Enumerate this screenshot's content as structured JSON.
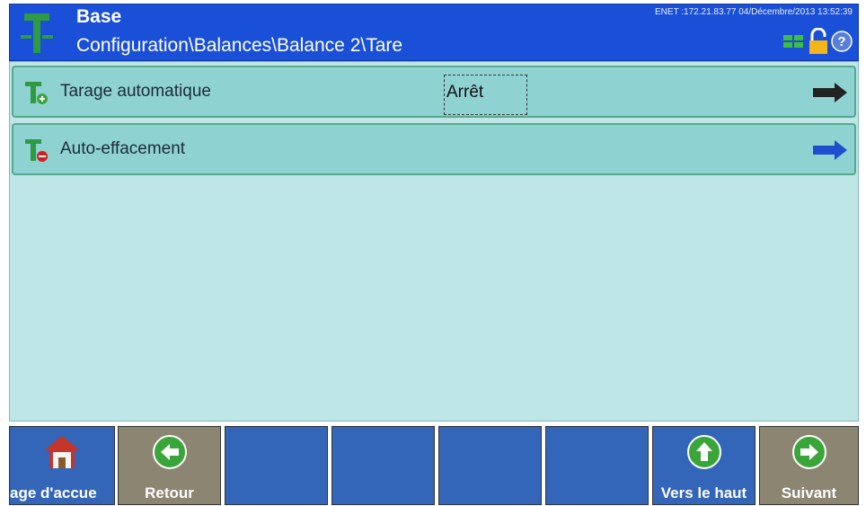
{
  "header": {
    "title": "Base",
    "path": "Configuration\\Balances\\Balance 2\\Tare",
    "status": "ENET :172.21.83.77  04/Décembre/2013 13:52:39",
    "icons": [
      "network-icon",
      "lock-icon",
      "help-icon"
    ]
  },
  "rows": [
    {
      "label": "Tarage automatique",
      "value": "Arrêt",
      "icon": "tare-add-icon",
      "arrow_color": "#222222"
    },
    {
      "label": "Auto-effacement",
      "icon": "tare-remove-icon",
      "arrow_color": "#1f4fcf"
    }
  ],
  "footer": {
    "home_label": "age d'accue",
    "back_label": "Retour",
    "up_label": "Vers le haut",
    "next_label": "Suivant"
  },
  "colors": {
    "header_bg": "#1a4fd8",
    "main_bg": "#bfe6e6",
    "row_bg": "#8fd2d2",
    "softkey_blue": "#3366b8",
    "softkey_tan": "#8c8571"
  }
}
